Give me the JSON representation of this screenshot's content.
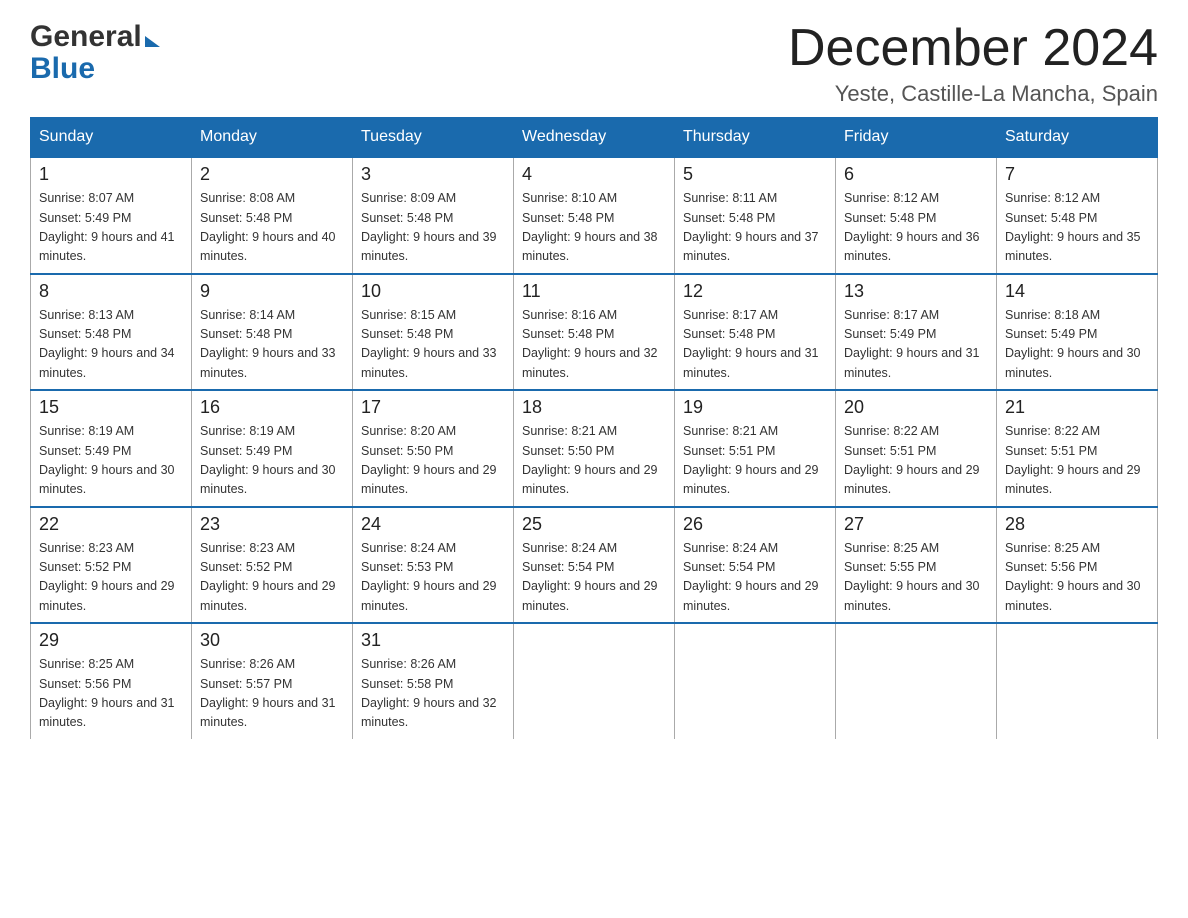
{
  "header": {
    "logo_general": "General",
    "logo_blue": "Blue",
    "month_title": "December 2024",
    "location": "Yeste, Castille-La Mancha, Spain"
  },
  "weekdays": [
    "Sunday",
    "Monday",
    "Tuesday",
    "Wednesday",
    "Thursday",
    "Friday",
    "Saturday"
  ],
  "weeks": [
    [
      {
        "day": "1",
        "sunrise": "8:07 AM",
        "sunset": "5:49 PM",
        "daylight": "9 hours and 41 minutes."
      },
      {
        "day": "2",
        "sunrise": "8:08 AM",
        "sunset": "5:48 PM",
        "daylight": "9 hours and 40 minutes."
      },
      {
        "day": "3",
        "sunrise": "8:09 AM",
        "sunset": "5:48 PM",
        "daylight": "9 hours and 39 minutes."
      },
      {
        "day": "4",
        "sunrise": "8:10 AM",
        "sunset": "5:48 PM",
        "daylight": "9 hours and 38 minutes."
      },
      {
        "day": "5",
        "sunrise": "8:11 AM",
        "sunset": "5:48 PM",
        "daylight": "9 hours and 37 minutes."
      },
      {
        "day": "6",
        "sunrise": "8:12 AM",
        "sunset": "5:48 PM",
        "daylight": "9 hours and 36 minutes."
      },
      {
        "day": "7",
        "sunrise": "8:12 AM",
        "sunset": "5:48 PM",
        "daylight": "9 hours and 35 minutes."
      }
    ],
    [
      {
        "day": "8",
        "sunrise": "8:13 AM",
        "sunset": "5:48 PM",
        "daylight": "9 hours and 34 minutes."
      },
      {
        "day": "9",
        "sunrise": "8:14 AM",
        "sunset": "5:48 PM",
        "daylight": "9 hours and 33 minutes."
      },
      {
        "day": "10",
        "sunrise": "8:15 AM",
        "sunset": "5:48 PM",
        "daylight": "9 hours and 33 minutes."
      },
      {
        "day": "11",
        "sunrise": "8:16 AM",
        "sunset": "5:48 PM",
        "daylight": "9 hours and 32 minutes."
      },
      {
        "day": "12",
        "sunrise": "8:17 AM",
        "sunset": "5:48 PM",
        "daylight": "9 hours and 31 minutes."
      },
      {
        "day": "13",
        "sunrise": "8:17 AM",
        "sunset": "5:49 PM",
        "daylight": "9 hours and 31 minutes."
      },
      {
        "day": "14",
        "sunrise": "8:18 AM",
        "sunset": "5:49 PM",
        "daylight": "9 hours and 30 minutes."
      }
    ],
    [
      {
        "day": "15",
        "sunrise": "8:19 AM",
        "sunset": "5:49 PM",
        "daylight": "9 hours and 30 minutes."
      },
      {
        "day": "16",
        "sunrise": "8:19 AM",
        "sunset": "5:49 PM",
        "daylight": "9 hours and 30 minutes."
      },
      {
        "day": "17",
        "sunrise": "8:20 AM",
        "sunset": "5:50 PM",
        "daylight": "9 hours and 29 minutes."
      },
      {
        "day": "18",
        "sunrise": "8:21 AM",
        "sunset": "5:50 PM",
        "daylight": "9 hours and 29 minutes."
      },
      {
        "day": "19",
        "sunrise": "8:21 AM",
        "sunset": "5:51 PM",
        "daylight": "9 hours and 29 minutes."
      },
      {
        "day": "20",
        "sunrise": "8:22 AM",
        "sunset": "5:51 PM",
        "daylight": "9 hours and 29 minutes."
      },
      {
        "day": "21",
        "sunrise": "8:22 AM",
        "sunset": "5:51 PM",
        "daylight": "9 hours and 29 minutes."
      }
    ],
    [
      {
        "day": "22",
        "sunrise": "8:23 AM",
        "sunset": "5:52 PM",
        "daylight": "9 hours and 29 minutes."
      },
      {
        "day": "23",
        "sunrise": "8:23 AM",
        "sunset": "5:52 PM",
        "daylight": "9 hours and 29 minutes."
      },
      {
        "day": "24",
        "sunrise": "8:24 AM",
        "sunset": "5:53 PM",
        "daylight": "9 hours and 29 minutes."
      },
      {
        "day": "25",
        "sunrise": "8:24 AM",
        "sunset": "5:54 PM",
        "daylight": "9 hours and 29 minutes."
      },
      {
        "day": "26",
        "sunrise": "8:24 AM",
        "sunset": "5:54 PM",
        "daylight": "9 hours and 29 minutes."
      },
      {
        "day": "27",
        "sunrise": "8:25 AM",
        "sunset": "5:55 PM",
        "daylight": "9 hours and 30 minutes."
      },
      {
        "day": "28",
        "sunrise": "8:25 AM",
        "sunset": "5:56 PM",
        "daylight": "9 hours and 30 minutes."
      }
    ],
    [
      {
        "day": "29",
        "sunrise": "8:25 AM",
        "sunset": "5:56 PM",
        "daylight": "9 hours and 31 minutes."
      },
      {
        "day": "30",
        "sunrise": "8:26 AM",
        "sunset": "5:57 PM",
        "daylight": "9 hours and 31 minutes."
      },
      {
        "day": "31",
        "sunrise": "8:26 AM",
        "sunset": "5:58 PM",
        "daylight": "9 hours and 32 minutes."
      },
      null,
      null,
      null,
      null
    ]
  ]
}
